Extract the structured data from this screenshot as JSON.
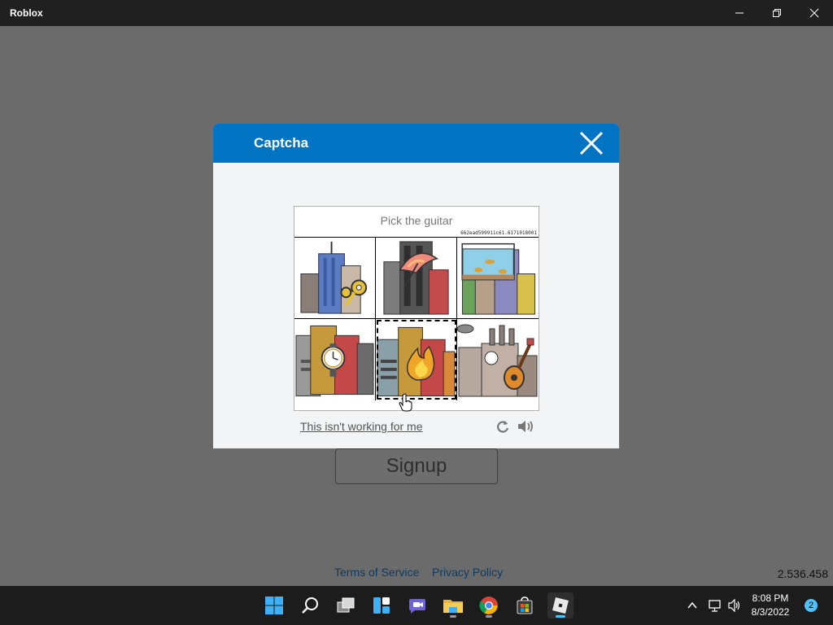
{
  "window": {
    "title": "Roblox"
  },
  "captcha": {
    "title": "Captcha",
    "prompt": "Pick the guitar",
    "challenge_id": "662ead599911c61.6171018001",
    "tiles": [
      {
        "name": "key",
        "selected": false
      },
      {
        "name": "umbrella",
        "selected": false
      },
      {
        "name": "aquarium",
        "selected": false
      },
      {
        "name": "watch",
        "selected": false
      },
      {
        "name": "fire",
        "selected": true
      },
      {
        "name": "guitar",
        "selected": false
      }
    ],
    "not_working_label": "This isn't working for me"
  },
  "signup": {
    "label": "Signup"
  },
  "footer": {
    "terms": "Terms of Service",
    "privacy": "Privacy Policy",
    "version": "2.536.458"
  },
  "taskbar": {
    "apps": [
      "start",
      "search",
      "task-view",
      "widgets",
      "teams-chat",
      "file-explorer",
      "chrome",
      "microsoft-store",
      "roblox"
    ],
    "active_app": "roblox",
    "time": "8:08 PM",
    "date": "8/3/2022",
    "notification_count": "2"
  },
  "colors": {
    "accent": "#0074c2",
    "background": "#6b6b6b",
    "taskbar": "#1c1c1c"
  }
}
